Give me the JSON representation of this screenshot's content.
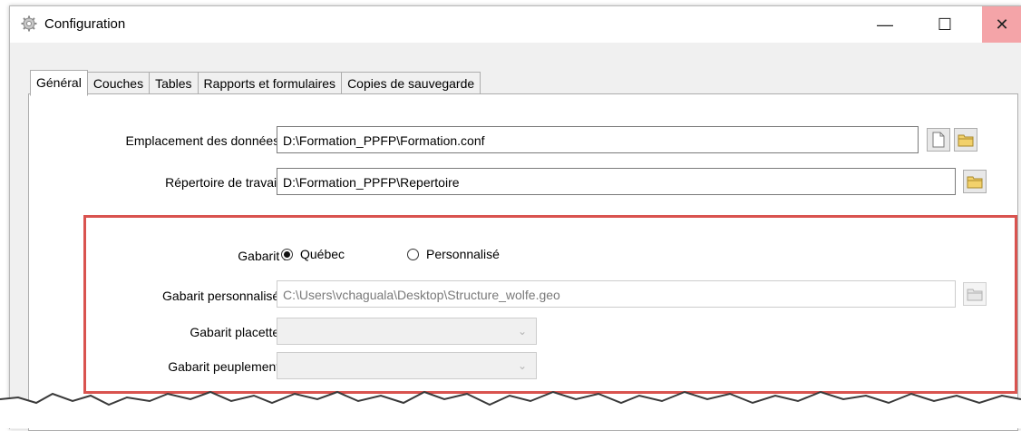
{
  "window": {
    "title": "Configuration",
    "controls": {
      "minimize": "—",
      "maximize": "☐",
      "close": "✕"
    }
  },
  "tabs": [
    {
      "label": "Général",
      "active": true
    },
    {
      "label": "Couches",
      "active": false
    },
    {
      "label": "Tables",
      "active": false
    },
    {
      "label": "Rapports et formulaires",
      "active": false
    },
    {
      "label": "Copies de sauvegarde",
      "active": false
    }
  ],
  "general": {
    "data_location": {
      "label": "Emplacement des données :",
      "value": "D:\\Formation_PPFP\\Formation.conf"
    },
    "work_directory": {
      "label": "Répertoire de travail :",
      "value": "D:\\Formation_PPFP\\Repertoire"
    },
    "template": {
      "label": "Gabarit :",
      "options": [
        {
          "label": "Québec",
          "selected": true
        },
        {
          "label": "Personnalisé",
          "selected": false
        }
      ]
    },
    "custom_template": {
      "label": "Gabarit personnalisé :",
      "value": "C:\\Users\\vchaguala\\Desktop\\Structure_wolfe.geo",
      "enabled": false
    },
    "plot_template": {
      "label": "Gabarit placette :",
      "value": "",
      "enabled": false
    },
    "stand_template": {
      "label": "Gabarit peuplement :",
      "value": "",
      "enabled": false
    }
  },
  "icons": {
    "app": "gear-icon",
    "new_file": "new-file-icon",
    "folder": "folder-icon"
  },
  "colors": {
    "highlight_border": "#d9534f",
    "close_hover": "#f4a4a8",
    "folder_yellow": "#f2d16b"
  }
}
